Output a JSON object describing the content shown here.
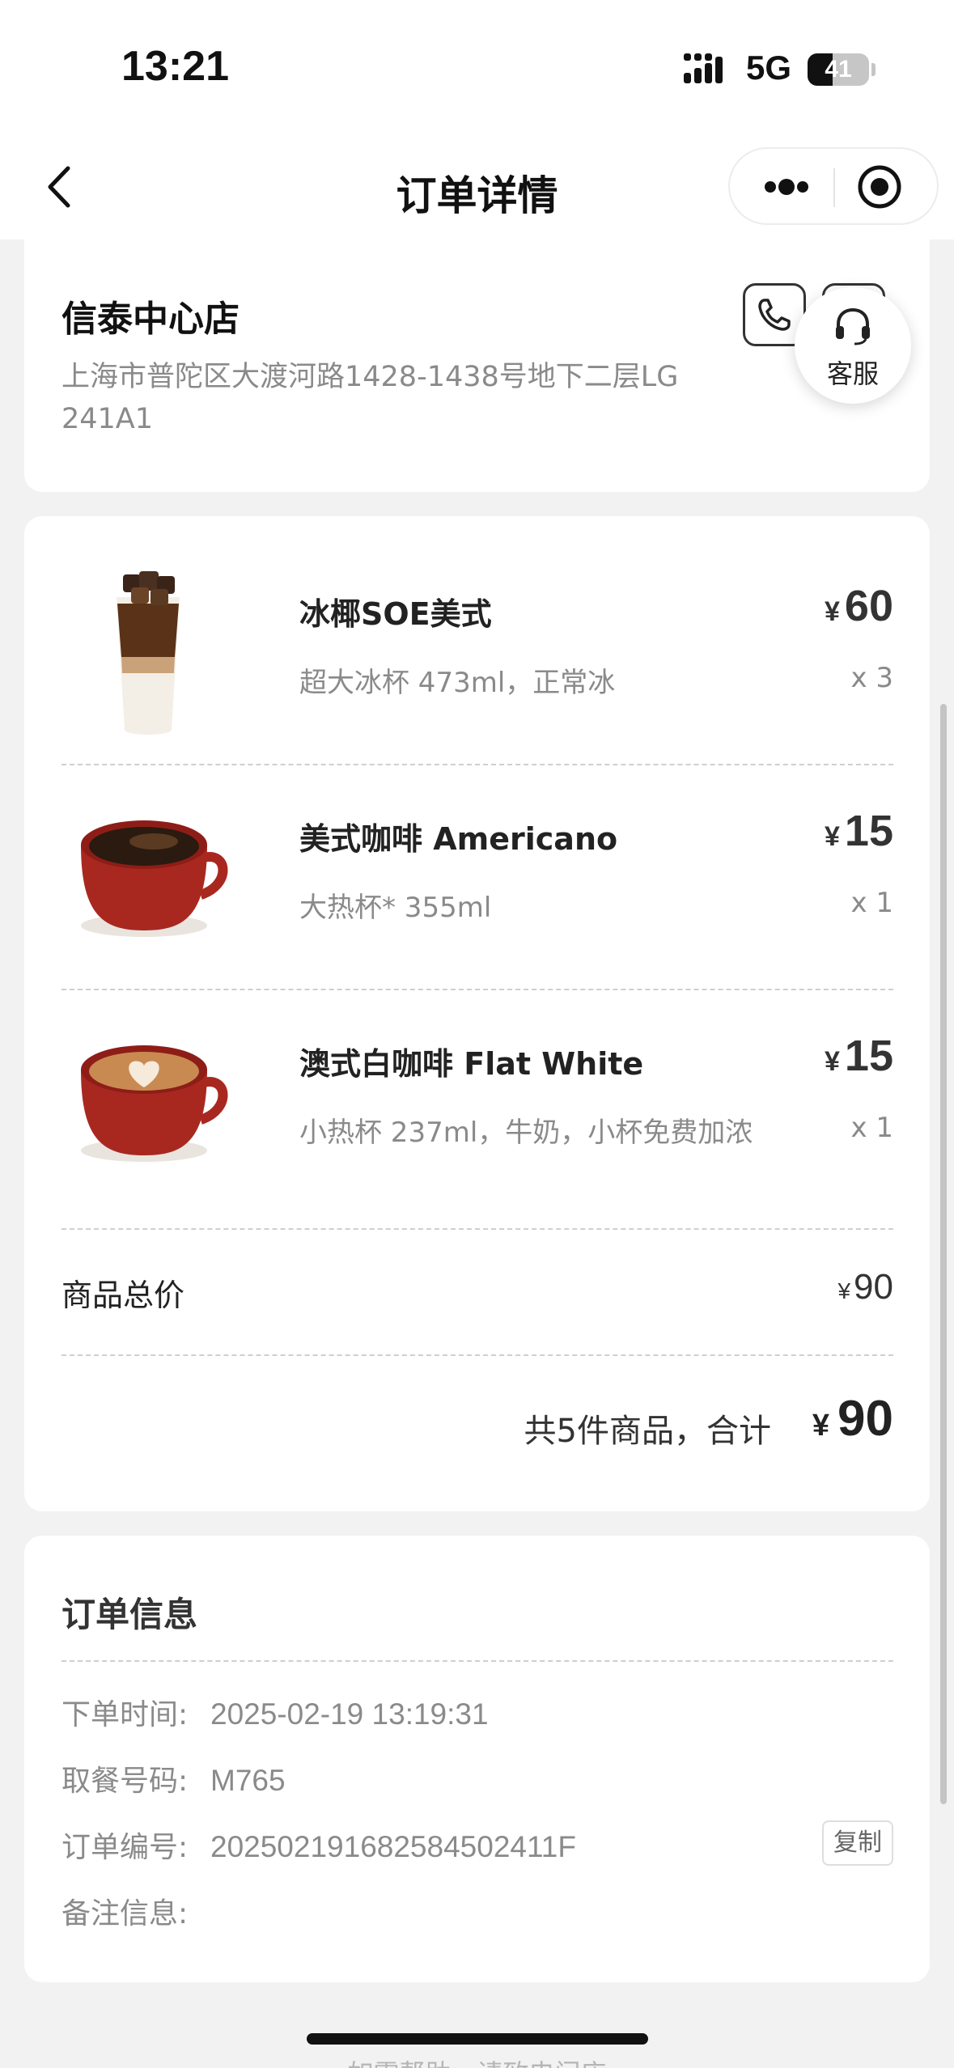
{
  "status_bar": {
    "time": "13:21",
    "network": "5G",
    "battery": "41",
    "battery_level": 0.41
  },
  "nav": {
    "title": "订单详情",
    "back_icon": "chevron-left-icon",
    "more_icon": "more-dots-icon",
    "target_icon": "target-icon"
  },
  "store": {
    "name": "信泰中心店",
    "address": "上海市普陀区大渡河路1428-1438号地下二层LG 241A1",
    "phone_icon": "phone-icon",
    "service_label": "客服",
    "service_icon": "headset-icon"
  },
  "items": [
    {
      "name": "冰椰SOE美式",
      "spec": "超大冰杯 473ml，正常冰",
      "currency": "¥",
      "price": "60",
      "qty": "x 3",
      "image": "iced-coconut-coffee-image"
    },
    {
      "name": "美式咖啡 Americano",
      "spec": "大热杯* 355ml",
      "currency": "¥",
      "price": "15",
      "qty": "x 1",
      "image": "americano-cup-image"
    },
    {
      "name": "澳式白咖啡 Flat White",
      "spec": "小热杯 237ml，牛奶，小杯免费加浓",
      "currency": "¥",
      "price": "15",
      "qty": "x 1",
      "image": "flat-white-cup-image"
    }
  ],
  "summary": {
    "subtotal_label": "商品总价",
    "subtotal_currency": "¥",
    "subtotal_value": "90",
    "total_label": "共5件商品，合计",
    "total_currency": "¥",
    "total_value": "90"
  },
  "order_info": {
    "title": "订单信息",
    "rows": [
      {
        "label": "下单时间:",
        "value": "2025-02-19 13:19:31"
      },
      {
        "label": "取餐号码:",
        "value": "M765"
      },
      {
        "label": "订单编号:",
        "value": "20250219168258450241​1F"
      },
      {
        "label": "备注信息:",
        "value": ""
      }
    ],
    "copy_label": "复制"
  },
  "footer_hint": "如需帮助，请致电门店"
}
